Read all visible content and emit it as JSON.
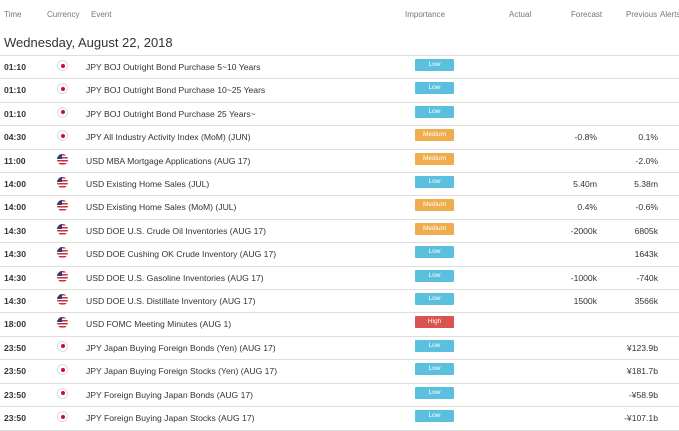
{
  "header": {
    "time": "Time",
    "currency": "Currency",
    "event": "Event",
    "importance": "Importance",
    "actual": "Actual",
    "forecast": "Forecast",
    "previous": "Previous",
    "alerts": "Alerts"
  },
  "date": "Wednesday, August 22, 2018",
  "colors": {
    "low": "#5bc0de",
    "medium": "#f0ad4e",
    "high": "#d9534f"
  },
  "rows": [
    {
      "time": "01:10",
      "flag": "jp",
      "flag_icon": "japan-flag-icon",
      "event": "JPY BOJ Outright Bond Purchase 5~10 Years",
      "importance": "Low",
      "level": "low",
      "actual": "",
      "forecast": "",
      "previous": ""
    },
    {
      "time": "01:10",
      "flag": "jp",
      "flag_icon": "japan-flag-icon",
      "event": "JPY BOJ Outright Bond Purchase 10~25 Years",
      "importance": "Low",
      "level": "low",
      "actual": "",
      "forecast": "",
      "previous": ""
    },
    {
      "time": "01:10",
      "flag": "jp",
      "flag_icon": "japan-flag-icon",
      "event": "JPY BOJ Outright Bond Purchase 25 Years~",
      "importance": "Low",
      "level": "low",
      "actual": "",
      "forecast": "",
      "previous": ""
    },
    {
      "time": "04:30",
      "flag": "jp",
      "flag_icon": "japan-flag-icon",
      "event": "JPY All Industry Activity Index (MoM) (JUN)",
      "importance": "Medium",
      "level": "medium",
      "actual": "",
      "forecast": "-0.8%",
      "previous": "0.1%"
    },
    {
      "time": "11:00",
      "flag": "us",
      "flag_icon": "us-flag-icon",
      "event": "USD MBA Mortgage Applications (AUG 17)",
      "importance": "Medium",
      "level": "medium",
      "actual": "",
      "forecast": "",
      "previous": "-2.0%"
    },
    {
      "time": "14:00",
      "flag": "us",
      "flag_icon": "us-flag-icon",
      "event": "USD Existing Home Sales (JUL)",
      "importance": "Low",
      "level": "low",
      "actual": "",
      "forecast": "5.40m",
      "previous": "5.38m"
    },
    {
      "time": "14:00",
      "flag": "us",
      "flag_icon": "us-flag-icon",
      "event": "USD Existing Home Sales (MoM) (JUL)",
      "importance": "Medium",
      "level": "medium",
      "actual": "",
      "forecast": "0.4%",
      "previous": "-0.6%"
    },
    {
      "time": "14:30",
      "flag": "us",
      "flag_icon": "us-flag-icon",
      "event": "USD DOE U.S. Crude Oil Inventories (AUG 17)",
      "importance": "Medium",
      "level": "medium",
      "actual": "",
      "forecast": "-2000k",
      "previous": "6805k"
    },
    {
      "time": "14:30",
      "flag": "us",
      "flag_icon": "us-flag-icon",
      "event": "USD DOE Cushing OK Crude Inventory (AUG 17)",
      "importance": "Low",
      "level": "low",
      "actual": "",
      "forecast": "",
      "previous": "1643k"
    },
    {
      "time": "14:30",
      "flag": "us",
      "flag_icon": "us-flag-icon",
      "event": "USD DOE U.S. Gasoline Inventories (AUG 17)",
      "importance": "Low",
      "level": "low",
      "actual": "",
      "forecast": "-1000k",
      "previous": "-740k"
    },
    {
      "time": "14:30",
      "flag": "us",
      "flag_icon": "us-flag-icon",
      "event": "USD DOE U.S. Distillate Inventory (AUG 17)",
      "importance": "Low",
      "level": "low",
      "actual": "",
      "forecast": "1500k",
      "previous": "3566k"
    },
    {
      "time": "18:00",
      "flag": "us",
      "flag_icon": "us-flag-icon",
      "event": "USD FOMC Meeting Minutes (AUG 1)",
      "importance": "High",
      "level": "high",
      "actual": "",
      "forecast": "",
      "previous": ""
    },
    {
      "time": "23:50",
      "flag": "jp",
      "flag_icon": "japan-flag-icon",
      "event": "JPY Japan Buying Foreign Bonds (Yen) (AUG 17)",
      "importance": "Low",
      "level": "low",
      "actual": "",
      "forecast": "",
      "previous": "¥123.9b"
    },
    {
      "time": "23:50",
      "flag": "jp",
      "flag_icon": "japan-flag-icon",
      "event": "JPY Japan Buying Foreign Stocks (Yen) (AUG 17)",
      "importance": "Low",
      "level": "low",
      "actual": "",
      "forecast": "",
      "previous": "¥181.7b"
    },
    {
      "time": "23:50",
      "flag": "jp",
      "flag_icon": "japan-flag-icon",
      "event": "JPY Foreign Buying Japan Bonds (AUG 17)",
      "importance": "Low",
      "level": "low",
      "actual": "",
      "forecast": "",
      "previous": "-¥58.9b"
    },
    {
      "time": "23:50",
      "flag": "jp",
      "flag_icon": "japan-flag-icon",
      "event": "JPY Foreign Buying Japan Stocks (AUG 17)",
      "importance": "Low",
      "level": "low",
      "actual": "",
      "forecast": "",
      "previous": "-¥107.1b"
    }
  ]
}
